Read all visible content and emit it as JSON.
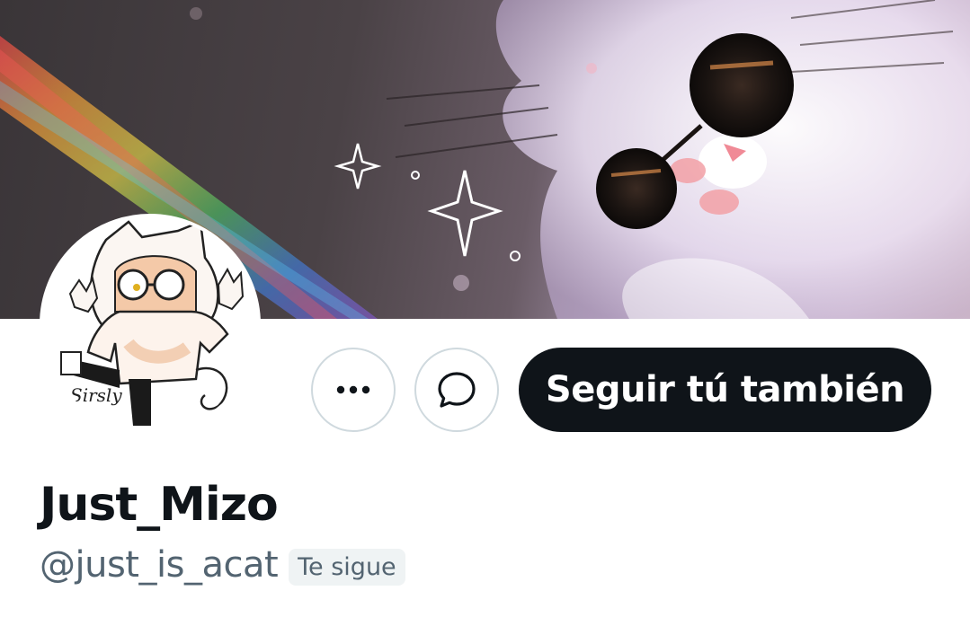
{
  "profile": {
    "display_name": "Just_Mizo",
    "handle": "@just_is_acat",
    "follows_you_badge": "Te sigue",
    "avatar_signature": "Sirsly"
  },
  "actions": {
    "more_icon": "more-horizontal-icon",
    "message_icon": "message-bubble-icon",
    "follow_label": "Seguir tú también"
  },
  "colors": {
    "primary_text": "#0f1419",
    "secondary_text": "#536471",
    "button_border": "#cfd9de",
    "follow_button_bg": "#0f1419",
    "badge_bg": "#eff3f4"
  }
}
